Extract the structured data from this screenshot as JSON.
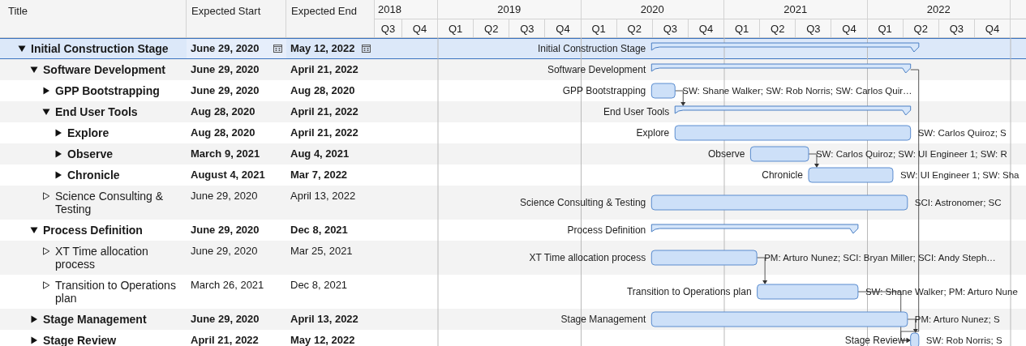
{
  "columns": [
    "Title",
    "Expected Start",
    "Expected End"
  ],
  "timeline": {
    "years": [
      {
        "label": "2018",
        "quarters": [
          "Q3",
          "Q4"
        ]
      },
      {
        "label": "2019",
        "quarters": [
          "Q1",
          "Q2",
          "Q3",
          "Q4"
        ]
      },
      {
        "label": "2020",
        "quarters": [
          "Q1",
          "Q2",
          "Q3",
          "Q4"
        ]
      },
      {
        "label": "2021",
        "quarters": [
          "Q1",
          "Q2",
          "Q3",
          "Q4"
        ]
      },
      {
        "label": "2022",
        "quarters": [
          "Q1",
          "Q2",
          "Q3",
          "Q4"
        ]
      }
    ]
  },
  "tasks": [
    {
      "title": "Initial Construction Stage",
      "kind": "group",
      "expanded": true,
      "selected": true,
      "start": "June 29, 2020",
      "end": "May 12, 2022",
      "bar_label": "Initial Construction Stage",
      "children": [
        {
          "title": "Software Development",
          "kind": "group",
          "expanded": true,
          "selected": false,
          "start": "June 29, 2020",
          "end": "April 21, 2022",
          "bar_label": "Software Development",
          "children": [
            {
              "title": "GPP Bootstrapping",
              "kind": "group",
              "expanded": false,
              "selected": false,
              "start": "June 29, 2020",
              "end": "Aug 28, 2020",
              "bar_label": "GPP Bootstrapping",
              "resources": "SW: Shane Walker; SW: Rob Norris; SW: Carlos Quir…"
            },
            {
              "title": "End User Tools",
              "kind": "group",
              "expanded": true,
              "selected": false,
              "start": "Aug 28, 2020",
              "end": "April 21, 2022",
              "bar_label": "End User Tools",
              "children": [
                {
                  "title": "Explore",
                  "kind": "group",
                  "expanded": false,
                  "selected": false,
                  "start": "Aug 28, 2020",
                  "end": "April 21, 2022",
                  "bar_label": "Explore",
                  "resources": "SW: Carlos Quiroz; S"
                },
                {
                  "title": "Observe",
                  "kind": "group",
                  "expanded": false,
                  "selected": false,
                  "start": "March 9, 2021",
                  "end": "Aug 4, 2021",
                  "bar_label": "Observe",
                  "resources": "SW: Carlos Quiroz; SW: UI Engineer 1; SW: R"
                },
                {
                  "title": "Chronicle",
                  "kind": "group",
                  "expanded": false,
                  "selected": false,
                  "start": "August 4, 2021",
                  "end": "Mar 7, 2022",
                  "bar_label": "Chronicle",
                  "resources": "SW: UI Engineer 1; SW: Sha"
                }
              ]
            },
            {
              "title": "Science Consulting & Testing",
              "kind": "task",
              "selected": false,
              "start": "June 29, 2020",
              "end": "April 13, 2022",
              "bar_label": "Science Consulting & Testing",
              "resources": "SCI: Astronomer; SC"
            }
          ]
        },
        {
          "title": "Process Definition",
          "kind": "group",
          "expanded": true,
          "selected": false,
          "start": "June 29, 2020",
          "end": "Dec 8, 2021",
          "bar_label": "Process Definition",
          "children": [
            {
              "title": "XT Time allocation process",
              "kind": "task",
              "selected": false,
              "start": "June 29, 2020",
              "end": "Mar 25, 2021",
              "bar_label": "XT Time allocation process",
              "resources": "PM: Arturo Nunez; SCI: Bryan Miller; SCI: Andy Steph…"
            },
            {
              "title": "Transition to Operations plan",
              "kind": "task",
              "selected": false,
              "start": "March 26, 2021",
              "end": "Dec 8, 2021",
              "bar_label": "Transition to Operations plan",
              "resources": "SW: Shane Walker; PM: Arturo Nune"
            }
          ]
        },
        {
          "title": "Stage Management",
          "kind": "group",
          "expanded": false,
          "selected": false,
          "start": "June 29, 2020",
          "end": "April 13, 2022",
          "bar_label": "Stage Management",
          "resources": "PM: Arturo Nunez; S"
        },
        {
          "title": "Stage Review",
          "kind": "group",
          "expanded": false,
          "selected": false,
          "start": "April 21, 2022",
          "end": "May 12, 2022",
          "bar_label": "Stage Review",
          "resources": "SW: Rob Norris; S"
        }
      ]
    }
  ]
}
